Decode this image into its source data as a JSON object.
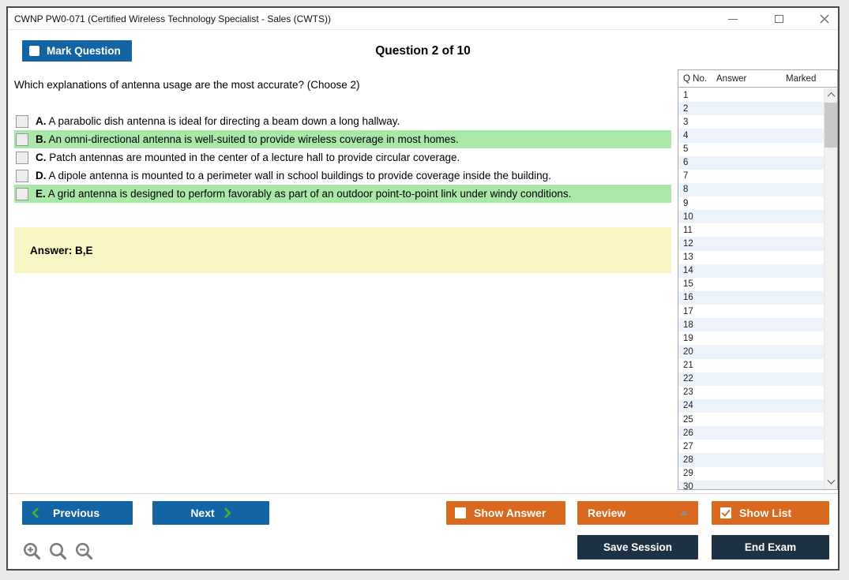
{
  "window": {
    "title": "CWNP PW0-071 (Certified Wireless Technology Specialist - Sales (CWTS))"
  },
  "header": {
    "mark_question_label": "Mark Question",
    "question_counter": "Question 2 of 10"
  },
  "question": {
    "text": "Which explanations of antenna usage are the most accurate? (Choose 2)",
    "options": [
      {
        "letter": "A.",
        "text": "A parabolic dish antenna is ideal for directing a beam down a long hallway.",
        "highlighted": false,
        "checked": false
      },
      {
        "letter": "B.",
        "text": "An omni-directional antenna is well-suited to provide wireless coverage in most homes.",
        "highlighted": true,
        "checked": false
      },
      {
        "letter": "C.",
        "text": "Patch antennas are mounted in the center of a lecture hall to provide circular coverage.",
        "highlighted": false,
        "checked": false
      },
      {
        "letter": "D.",
        "text": "A dipole antenna is mounted to a perimeter wall in school buildings to provide coverage inside the building.",
        "highlighted": false,
        "checked": false
      },
      {
        "letter": "E.",
        "text": "A grid antenna is designed to perform favorably as part of an outdoor point-to-point link under windy conditions.",
        "highlighted": true,
        "checked": false
      }
    ]
  },
  "answer_panel": {
    "text": "Answer: B,E"
  },
  "question_list": {
    "headers": [
      "Q No.",
      "Answer",
      "Marked"
    ],
    "rows": [
      {
        "q": "1",
        "answer": "",
        "marked": ""
      },
      {
        "q": "2",
        "answer": "",
        "marked": ""
      },
      {
        "q": "3",
        "answer": "",
        "marked": ""
      },
      {
        "q": "4",
        "answer": "",
        "marked": ""
      },
      {
        "q": "5",
        "answer": "",
        "marked": ""
      },
      {
        "q": "6",
        "answer": "",
        "marked": ""
      },
      {
        "q": "7",
        "answer": "",
        "marked": ""
      },
      {
        "q": "8",
        "answer": "",
        "marked": ""
      },
      {
        "q": "9",
        "answer": "",
        "marked": ""
      },
      {
        "q": "10",
        "answer": "",
        "marked": ""
      },
      {
        "q": "11",
        "answer": "",
        "marked": ""
      },
      {
        "q": "12",
        "answer": "",
        "marked": ""
      },
      {
        "q": "13",
        "answer": "",
        "marked": ""
      },
      {
        "q": "14",
        "answer": "",
        "marked": ""
      },
      {
        "q": "15",
        "answer": "",
        "marked": ""
      },
      {
        "q": "16",
        "answer": "",
        "marked": ""
      },
      {
        "q": "17",
        "answer": "",
        "marked": ""
      },
      {
        "q": "18",
        "answer": "",
        "marked": ""
      },
      {
        "q": "19",
        "answer": "",
        "marked": ""
      },
      {
        "q": "20",
        "answer": "",
        "marked": ""
      },
      {
        "q": "21",
        "answer": "",
        "marked": ""
      },
      {
        "q": "22",
        "answer": "",
        "marked": ""
      },
      {
        "q": "23",
        "answer": "",
        "marked": ""
      },
      {
        "q": "24",
        "answer": "",
        "marked": ""
      },
      {
        "q": "25",
        "answer": "",
        "marked": ""
      },
      {
        "q": "26",
        "answer": "",
        "marked": ""
      },
      {
        "q": "27",
        "answer": "",
        "marked": ""
      },
      {
        "q": "28",
        "answer": "",
        "marked": ""
      },
      {
        "q": "29",
        "answer": "",
        "marked": ""
      },
      {
        "q": "30",
        "answer": "",
        "marked": ""
      }
    ]
  },
  "footer": {
    "previous_label": "Previous",
    "next_label": "Next",
    "show_answer_label": "Show Answer",
    "review_label": "Review",
    "show_list_label": "Show List",
    "save_session_label": "Save Session",
    "end_exam_label": "End Exam",
    "show_answer_checked": false,
    "show_list_checked": true
  },
  "icons": {
    "minimize": "–",
    "maximize": "□",
    "close": "×",
    "mark_question_checkbox": "unchecked-box",
    "show_answer_checkbox": "unchecked-box",
    "show_list_checkbox": "checked-box",
    "previous_chevron": "❮",
    "next_chevron": "❯",
    "review_caret": "▲",
    "scroll_up": "chevron-up",
    "scroll_down": "chevron-down",
    "zoom_in": "magnifier-plus",
    "zoom_reset": "magnifier",
    "zoom_out": "magnifier-minus"
  },
  "colors": {
    "accent_blue": "#1464a4",
    "accent_orange": "#d9691e",
    "dark_navy": "#1d3245",
    "highlight_green": "#a9e8a9",
    "answer_yellow": "#faf5c4",
    "chevron_green": "#3db33d"
  }
}
